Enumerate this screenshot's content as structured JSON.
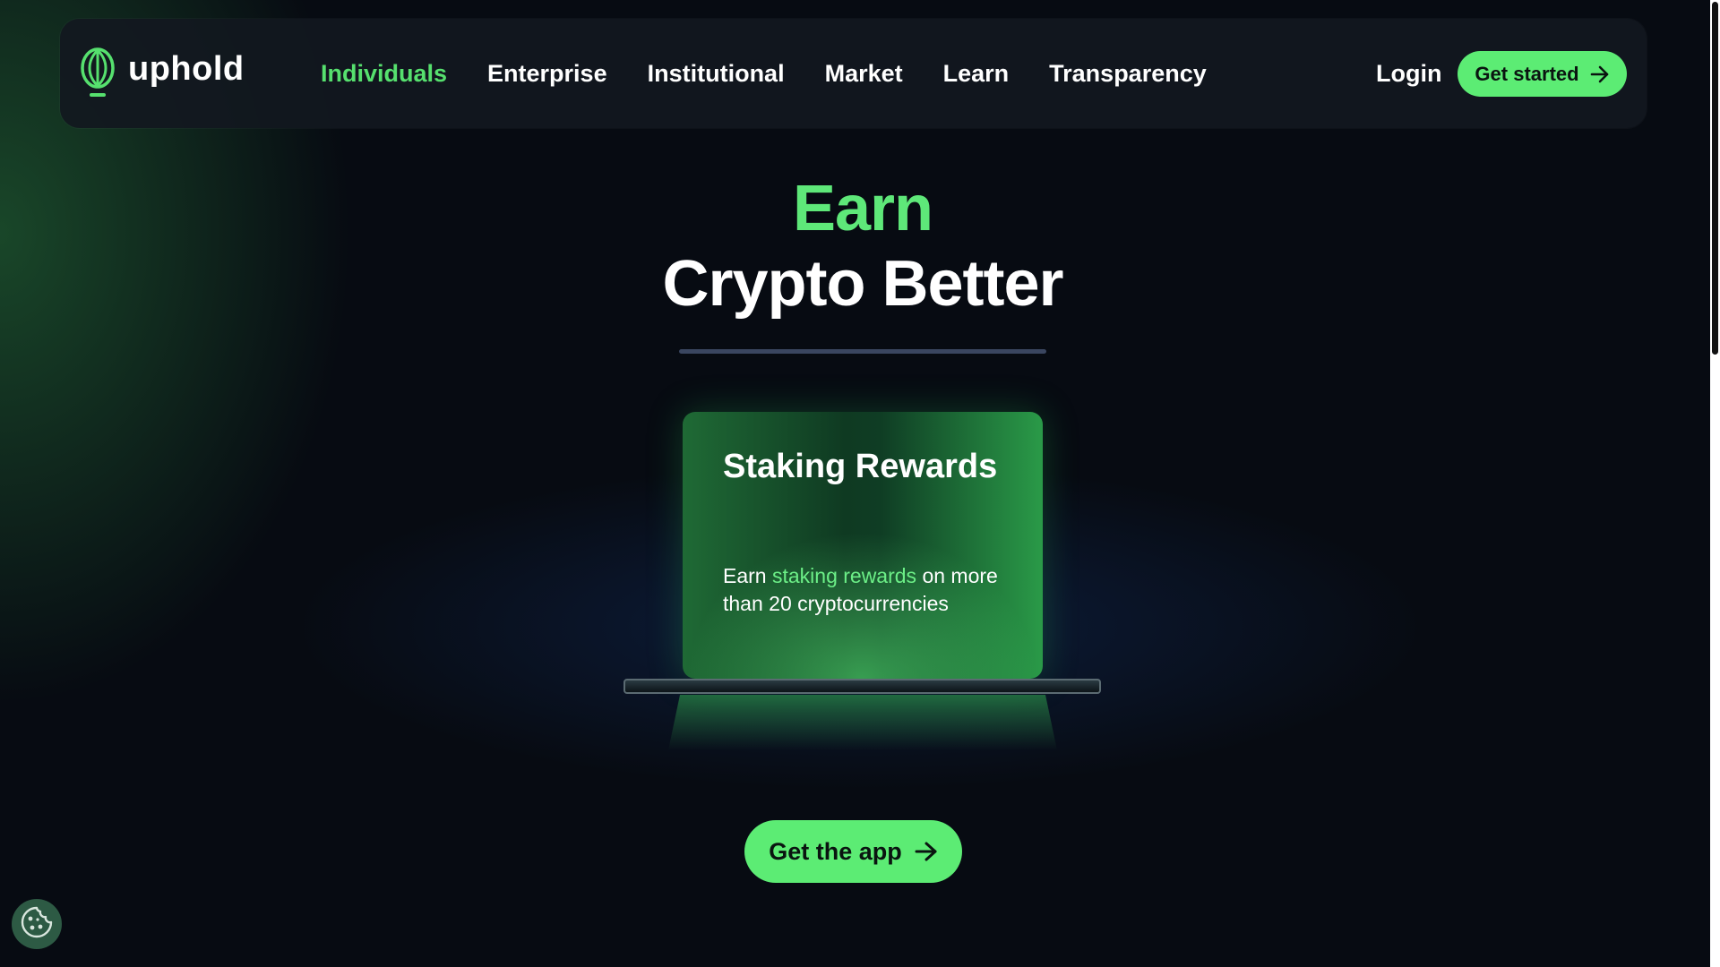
{
  "brand": {
    "name": "uphold",
    "logo_icon": "uphold-logo-icon",
    "accent_color": "#5cec74"
  },
  "nav": {
    "items": [
      {
        "label": "Individuals",
        "active": true
      },
      {
        "label": "Enterprise",
        "active": false
      },
      {
        "label": "Institutional",
        "active": false
      },
      {
        "label": "Market",
        "active": false
      },
      {
        "label": "Learn",
        "active": false
      },
      {
        "label": "Transparency",
        "active": false
      }
    ],
    "login_label": "Login",
    "get_started_label": "Get started",
    "get_started_icon": "arrow-right-icon"
  },
  "hero": {
    "line1": "Earn",
    "line2": "Crypto Better"
  },
  "card": {
    "title": "Staking Rewards",
    "body_prefix": "Earn ",
    "body_highlight": "staking rewards",
    "body_suffix": " on more than 20 cryptocurrencies"
  },
  "cta": {
    "get_app_label": "Get the app",
    "icon": "arrow-right-icon"
  },
  "cookie": {
    "icon": "cookie-icon"
  }
}
